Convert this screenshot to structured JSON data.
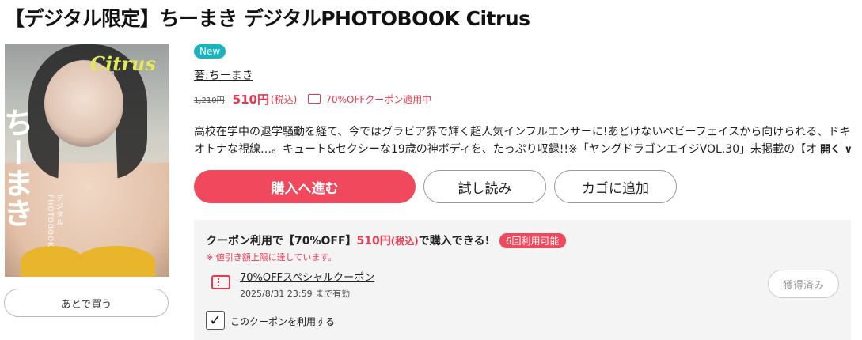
{
  "product": {
    "title": "【デジタル限定】ちーまき デジタルPHOTOBOOK Citrus",
    "badge": "New",
    "author": "著:ちーまき",
    "old_price": "1,210円",
    "price": "510円",
    "tax": "(税込)",
    "coupon_note": "70%OFFクーポン適用中",
    "description_line1": "高校在学中の退学騒動を経て、今ではグラビア界で輝く超人気インフルエンサーに!あどけないベビーフェイスから向けられる、ドキッとする",
    "description_line2": "オトナな視線…。キュート&セクシーな19歳の神ボディを、たっぷり収録!!※「ヤングドラゴンエイジVOL.30」未掲載の【オールアザーカ",
    "more_label": "開く ∨"
  },
  "cover": {
    "logo_text": "Citrus",
    "name_text": "ちーまき",
    "sub_text": "デジタルPHOTOBOOK"
  },
  "buttons": {
    "later": "あとで買う",
    "buy": "購入へ進む",
    "try": "試し読み",
    "cart": "カゴに追加"
  },
  "coupon_panel": {
    "title_pre": "クーポン利用で【70%OFF】",
    "title_price": "510円",
    "title_tax": "(税込)",
    "title_post": "で購入できる!",
    "uses_badge": "6回利用可能",
    "limit_note": "※ 値引き額上限に達しています。",
    "coupon_name": "70%OFFスペシャルクーポン",
    "valid_until": "2025/8/31 23:59 まで有効",
    "acquired_label": "獲得済み",
    "checkbox_label": "このクーポンを利用する",
    "checkbox_checked": true
  },
  "colors": {
    "accent": "#f0495d",
    "badge": "#19b3bd"
  }
}
